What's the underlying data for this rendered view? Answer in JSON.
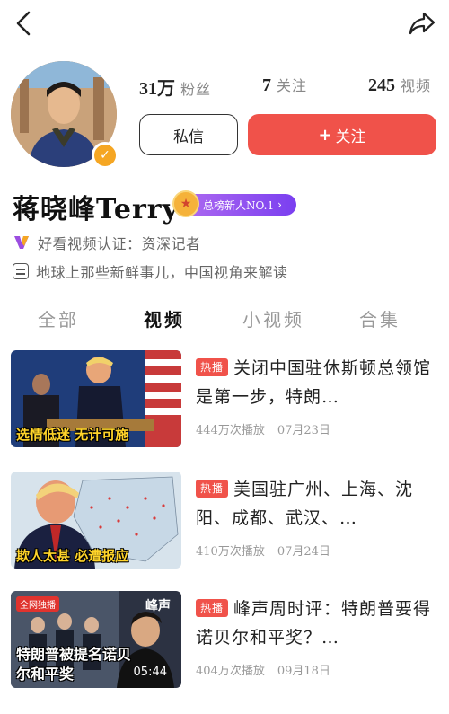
{
  "header": {
    "back_icon": "chevron-left-icon",
    "share_icon": "share-arrow-icon"
  },
  "profile": {
    "name": "蒋晓峰Terry",
    "rank_badge": "总榜新人NO.1",
    "verification": "好看视频认证：资深记者",
    "bio": "地球上那些新鲜事儿，中国视角来解读",
    "stats": [
      {
        "value": "31万",
        "label": "粉丝"
      },
      {
        "value": "7",
        "label": "关注"
      },
      {
        "value": "245",
        "label": "视频"
      }
    ],
    "message_button": "私信",
    "follow_button": "关注"
  },
  "tabs": [
    {
      "label": "全部",
      "active": false
    },
    {
      "label": "视频",
      "active": true
    },
    {
      "label": "小视频",
      "active": false
    },
    {
      "label": "合集",
      "active": false
    }
  ],
  "videos": [
    {
      "hot_label": "热播",
      "title": "关闭中国驻休斯顿总领馆是第一步，特朗…",
      "thumb_caption": "选情低迷 无计可施",
      "views": "444万次播放",
      "date": "07月23日"
    },
    {
      "hot_label": "热播",
      "title": "美国驻广州、上海、沈阳、成都、武汉、…",
      "thumb_caption": "欺人太甚 必遭报应",
      "views": "410万次播放",
      "date": "07月24日"
    },
    {
      "hot_label": "热播",
      "title": "峰声周时评：特朗普要得诺贝尔和平奖？…",
      "thumb_caption": "特朗普被提名诺贝尔和平奖",
      "thumb_tag": "全网独播",
      "thumb_logo": "峰声",
      "duration": "05:44",
      "views": "404万次播放",
      "date": "09月18日"
    }
  ],
  "colors": {
    "accent": "#f0524a",
    "badge_purple": "#8a4ff0",
    "verified": "#f5a623"
  }
}
